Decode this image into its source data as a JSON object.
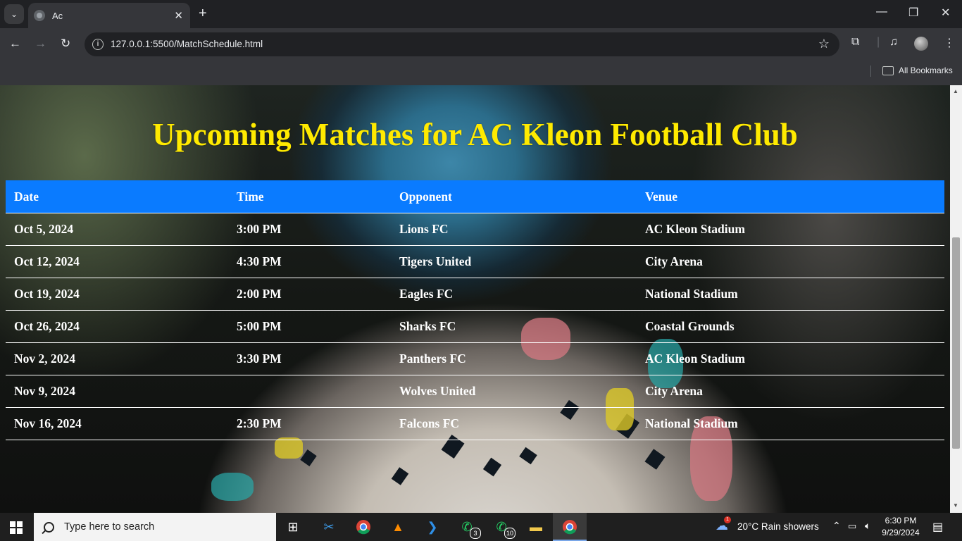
{
  "browser": {
    "tab_title": "Ac",
    "url": "127.0.0.1:5500/MatchSchedule.html",
    "bookmarks_label": "All Bookmarks"
  },
  "page": {
    "title": "Upcoming Matches for AC Kleon Football Club",
    "table": {
      "headers": [
        "Date",
        "Time",
        "Opponent",
        "Venue"
      ],
      "rows": [
        [
          "Oct 5, 2024",
          "3:00 PM",
          "Lions FC",
          "AC Kleon Stadium"
        ],
        [
          "Oct 12, 2024",
          "4:30 PM",
          "Tigers United",
          "City Arena"
        ],
        [
          "Oct 19, 2024",
          "2:00 PM",
          "Eagles FC",
          "National Stadium"
        ],
        [
          "Oct 26, 2024",
          "5:00 PM",
          "Sharks FC",
          "Coastal Grounds"
        ],
        [
          "Nov 2, 2024",
          "3:30 PM",
          "Panthers FC",
          "AC Kleon Stadium"
        ],
        [
          "Nov 9, 2024",
          "",
          "Wolves United",
          "City Arena"
        ],
        [
          "Nov 16, 2024",
          "2:30 PM",
          "Falcons FC",
          "National Stadium"
        ]
      ]
    },
    "colors": {
      "title": "#ffea00",
      "header_bg": "#0a7bff"
    }
  },
  "taskbar": {
    "search_placeholder": "Type here to search",
    "whatsapp_badge_1": "3",
    "whatsapp_badge_2": "10",
    "weather_badge": "1",
    "weather": "20°C  Rain showers",
    "time": "6:30 PM",
    "date": "9/29/2024"
  }
}
